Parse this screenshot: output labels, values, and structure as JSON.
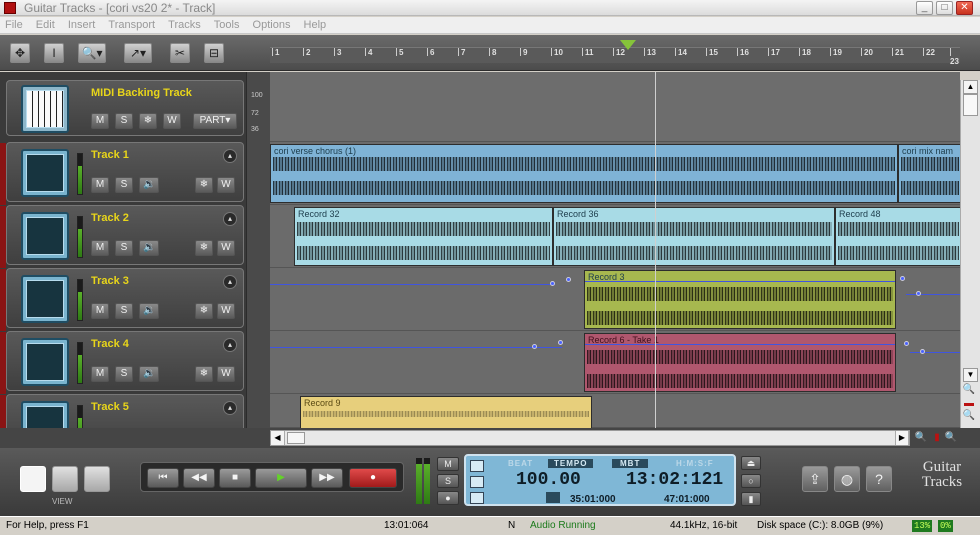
{
  "window": {
    "title": "Guitar Tracks - [cori vs20 2* - Track]"
  },
  "menu": [
    "File",
    "Edit",
    "Insert",
    "Transport",
    "Tracks",
    "Tools",
    "Options",
    "Help"
  ],
  "ruler": [
    "1",
    "2",
    "3",
    "4",
    "5",
    "6",
    "7",
    "8",
    "9",
    "10",
    "11",
    "12",
    "13",
    "14",
    "15",
    "16",
    "17",
    "18",
    "19",
    "20",
    "21",
    "22",
    "23"
  ],
  "scale": {
    "top": "100",
    "mid": "72",
    "low": "36"
  },
  "tracks": [
    {
      "name": "MIDI Backing Track",
      "buttons": [
        "M",
        "S",
        "",
        "W"
      ],
      "part": "PART▾"
    },
    {
      "name": "Track 1",
      "buttons": [
        "M",
        "S",
        "🔉",
        "",
        "W"
      ]
    },
    {
      "name": "Track 2",
      "buttons": [
        "M",
        "S",
        "🔉",
        "",
        "W"
      ]
    },
    {
      "name": "Track 3",
      "buttons": [
        "M",
        "S",
        "🔉",
        "",
        "W"
      ]
    },
    {
      "name": "Track 4",
      "buttons": [
        "M",
        "S",
        "🔉",
        "",
        "W"
      ]
    },
    {
      "name": "Track 5"
    }
  ],
  "clips": {
    "t1a": "cori verse chorus (1)",
    "t1b": "cori mix nam",
    "t2a": "Record 32",
    "t2b": "Record 36",
    "t2c": "Record 48",
    "t3a": "Record 3",
    "t4a": "Record 6 - Take 1",
    "t5a": "Record 9"
  },
  "view": {
    "label": "VIEW"
  },
  "transport": {
    "buttons": [
      "⏮",
      "◀◀",
      "■",
      "▶",
      "▶▶",
      "●"
    ]
  },
  "ms": [
    "M",
    "S",
    "●"
  ],
  "lcd": {
    "beat_label": "BEAT",
    "tempo_label": "TEMPO",
    "tempo": "100.00",
    "mbt_label": "MBT",
    "hmsf_label": "H:M:S:F",
    "time": "13:02:121",
    "loop_start": "35:01:000",
    "loop_end": "47:01:000"
  },
  "brand": {
    "line1": "Guitar",
    "line2": "Tracks"
  },
  "status": {
    "help": "For Help, press F1",
    "pos": "13:01:064",
    "mode": "N",
    "audio": "Audio Running",
    "format": "44.1kHz, 16-bit",
    "disk": "Disk space (C:): 8.0GB (9%)",
    "cpu1": "13%",
    "cpu2": "0%"
  }
}
